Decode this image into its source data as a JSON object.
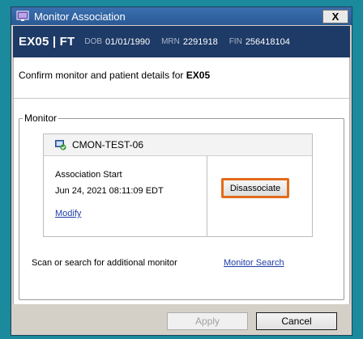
{
  "window": {
    "title": "Monitor Association",
    "close_label": "X"
  },
  "banner": {
    "patient": "EX05 | FT",
    "dob_label": "DOB",
    "dob_value": "01/01/1990",
    "mrn_label": "MRN",
    "mrn_value": "2291918",
    "fin_label": "FIN",
    "fin_value": "256418104"
  },
  "confirm": {
    "prefix": "Confirm monitor and patient details for",
    "patient_code": "EX05"
  },
  "monitor_group": {
    "legend": "Monitor",
    "monitor_name": "CMON-TEST-06",
    "association_label": "Association Start",
    "association_value": "Jun 24, 2021 08:11:09 EDT",
    "modify_label": "Modify",
    "disassociate_label": "Disassociate",
    "scan_text": "Scan or search for additional monitor",
    "search_link": "Monitor Search"
  },
  "buttons": {
    "apply": "Apply",
    "cancel": "Cancel"
  },
  "icons": {
    "app": "app-window-icon",
    "monitor": "monitor-check-icon"
  },
  "colors": {
    "banner": "#1e3a66",
    "highlight": "#e36b1c",
    "link": "#1f3ea8"
  }
}
